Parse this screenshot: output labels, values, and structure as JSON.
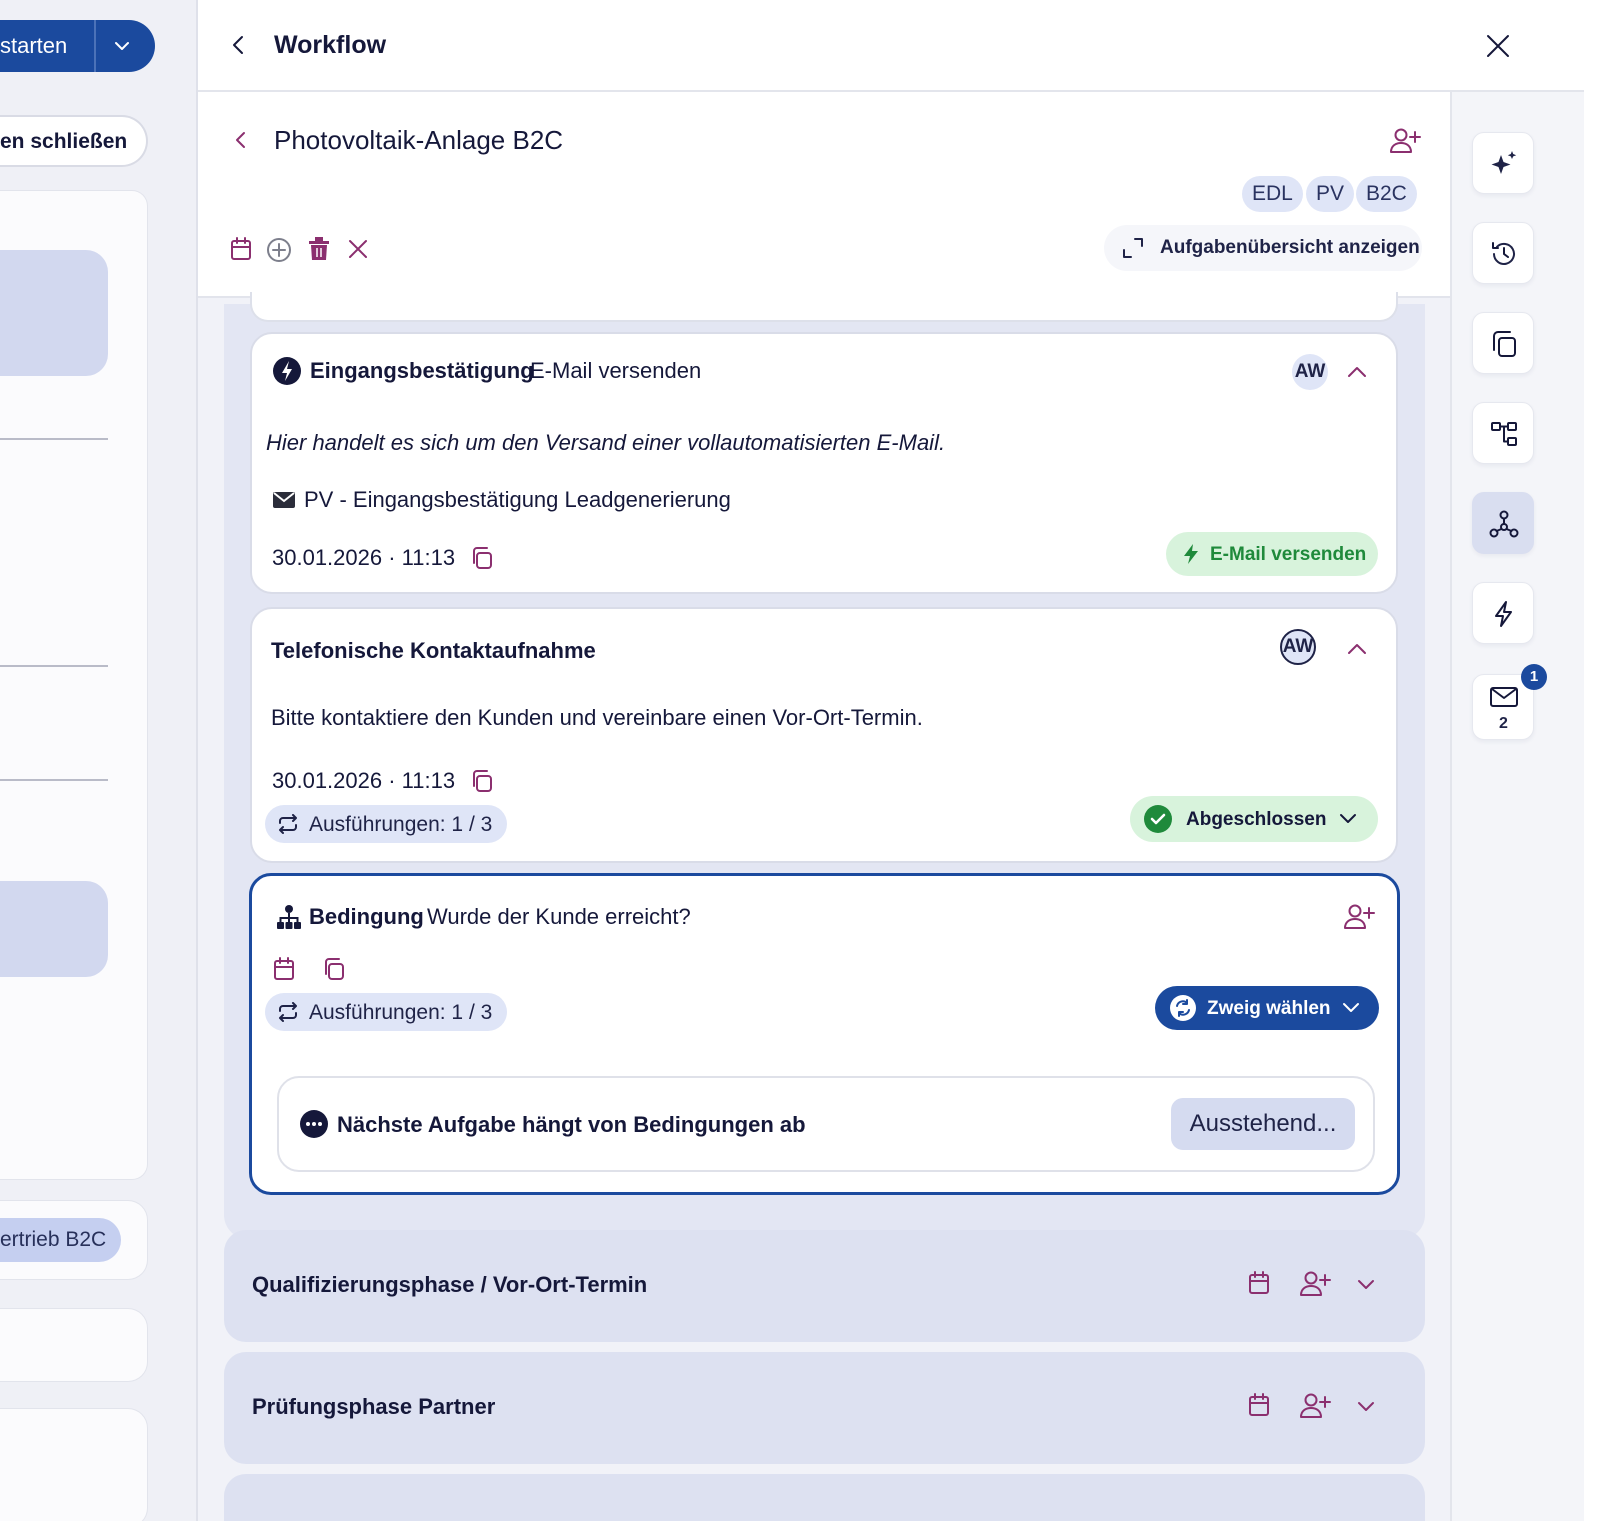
{
  "left": {
    "start_button_label": "starten",
    "close_button_label": "en schließen",
    "tag_label": "ertrieb B2C"
  },
  "header": {
    "title": "Workflow"
  },
  "process": {
    "title": "Photovoltaik-Anlage B2C",
    "tags": [
      "EDL",
      "PV",
      "B2C"
    ],
    "overview_button": "Aufgabenübersicht anzeigen"
  },
  "tasks": [
    {
      "type_label": "Eingangsbestätigung",
      "title": "E-Mail versenden",
      "assignee": "AW",
      "description": "Hier handelt es sich um den Versand einer vollautomatisierten E-Mail.",
      "email_template": "PV - Eingangsbestätigung Leadgenerierung",
      "date": "30.01.2026 · 11:13",
      "action_label": "E-Mail versenden"
    },
    {
      "title": "Telefonische Kontaktaufnahme",
      "assignee": "AW",
      "description": "Bitte kontaktiere den Kunden und vereinbare einen Vor-Ort-Termin.",
      "date": "30.01.2026 · 11:13",
      "executions": "Ausführungen: 1 / 3",
      "status_label": "Abgeschlossen"
    },
    {
      "type_label": "Bedingung",
      "title": "Wurde der Kunde erreicht?",
      "executions": "Ausführungen: 1 / 3",
      "branch_button": "Zweig wählen",
      "next_task_text": "Nächste Aufgabe hängt von Bedingungen ab",
      "pending_label": "Ausstehend..."
    }
  ],
  "phases": [
    {
      "title": "Qualifizierungsphase / Vor-Ort-Termin"
    },
    {
      "title": "Prüfungsphase Partner"
    }
  ],
  "rail": {
    "mail_count": "2",
    "notification_badge": "1"
  },
  "colors": {
    "primary": "#1b4a9e",
    "accent_purple": "#8b2f6f",
    "success_green": "#1f8a3b",
    "success_bg": "#d8f3dc",
    "tag_bg": "#dfe5f7"
  }
}
